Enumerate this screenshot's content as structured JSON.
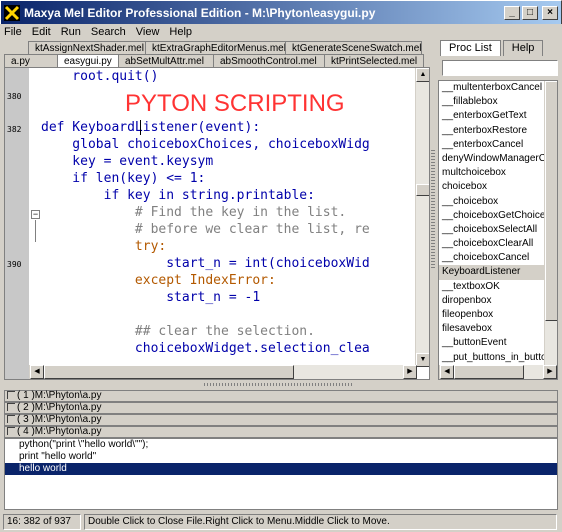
{
  "window": {
    "title": "Maxya Mel Editor Professional Edition - M:\\Phyton\\easygui.py",
    "minimize": "_",
    "maximize": "□",
    "close": "×"
  },
  "menu": [
    "File",
    "Edit",
    "Run",
    "Search",
    "View",
    "Help"
  ],
  "tabs_row1": [
    "ktAssignNextShader.mel",
    "ktExtraGraphEditorMenus.mel",
    "ktGenerateSceneSwatch.mel"
  ],
  "tabs_row2": [
    "a.py",
    "easygui.py",
    "abSetMultAttr.mel",
    "abSmoothControl.mel",
    "ktPrintSelected.mel"
  ],
  "active_tab": "easygui.py",
  "editor": {
    "banner": "PYTON SCRIPTING",
    "line_numbers": [
      "380",
      "382",
      "390"
    ],
    "lines": [
      "    root.quit()",
      "",
      "def KeyboardListener(event):",
      "    global choiceboxChoices, choiceboxWidg",
      "    key = event.keysym",
      "    if len(key) <= 1:",
      "        if key in string.printable:",
      "            # Find the key in the list.",
      "            # before we clear the list, re",
      "            try:",
      "                start_n = int(choiceboxWid",
      "            except IndexError:",
      "                start_n = -1",
      "",
      "            ## clear the selection.",
      "            choiceboxWidget.selection_clea"
    ]
  },
  "right_panel": {
    "tabs": [
      "Proc List",
      "Help"
    ],
    "filter_value": "",
    "items": [
      "__multenterboxCancel",
      "__fillablebox",
      "__enterboxGetText",
      "__enterboxRestore",
      "__enterboxCancel",
      "denyWindowManagerCl",
      "multchoicebox",
      "choicebox",
      "__choicebox",
      "__choiceboxGetChoice",
      "__choiceboxSelectAll",
      "__choiceboxClearAll",
      "__choiceboxCancel",
      "KeyboardListener",
      "__textboxOK",
      "diropenbox",
      "fileopenbox",
      "filesavebox",
      "__buttonEvent",
      "__put_buttons_in_butto"
    ],
    "selected": "KeyboardListener"
  },
  "files": [
    "( 1 )M:\\Phyton\\a.py",
    "( 2 )M:\\Phyton\\a.py",
    "( 3 )M:\\Phyton\\a.py",
    "( 4 )M:\\Phyton\\a.py"
  ],
  "output": [
    "python(\"print \\\"hello world\\\"\");",
    "print \"hello world\"",
    "hello world"
  ],
  "status": {
    "position": "16: 382 of 937",
    "message": "Double Click to Close File.Right Click to Menu.Middle Click to Move."
  }
}
